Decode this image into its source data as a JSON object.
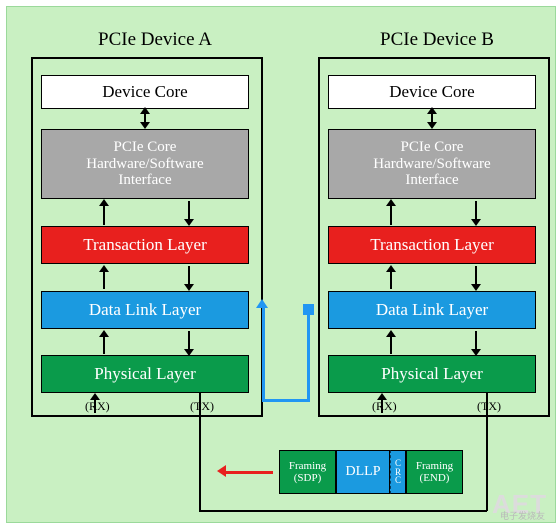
{
  "diagram": {
    "title_a": "PCIe Device A",
    "title_b": "PCIe Device B",
    "layers": [
      {
        "key": "core",
        "label": "Device Core"
      },
      {
        "key": "hwsw",
        "line1": "PCIe Core",
        "line2": "Hardware/Software",
        "line3": "Interface"
      },
      {
        "key": "transaction",
        "label": "Transaction Layer"
      },
      {
        "key": "datalink",
        "label": "Data Link Layer"
      },
      {
        "key": "physical",
        "label": "Physical Layer"
      }
    ],
    "port_labels": {
      "rx": "(RX)",
      "tx": "(TX)"
    },
    "packet": {
      "framing_start_line1": "Framing",
      "framing_start_line2": "(SDP)",
      "payload": "DLLP",
      "crc": "CRC",
      "framing_end_line1": "Framing",
      "framing_end_line2": "(END)"
    },
    "colors": {
      "background": "#c9f0c2",
      "transaction": "#e8201e",
      "datalink": "#1b9ae0",
      "physical": "#0a9b4b",
      "hwsw": "#a8a8a8",
      "blue_path": "#2196f3",
      "red_arrow": "#e8201e"
    },
    "watermark": "AET",
    "watermark_sub": "电子发烧友"
  }
}
